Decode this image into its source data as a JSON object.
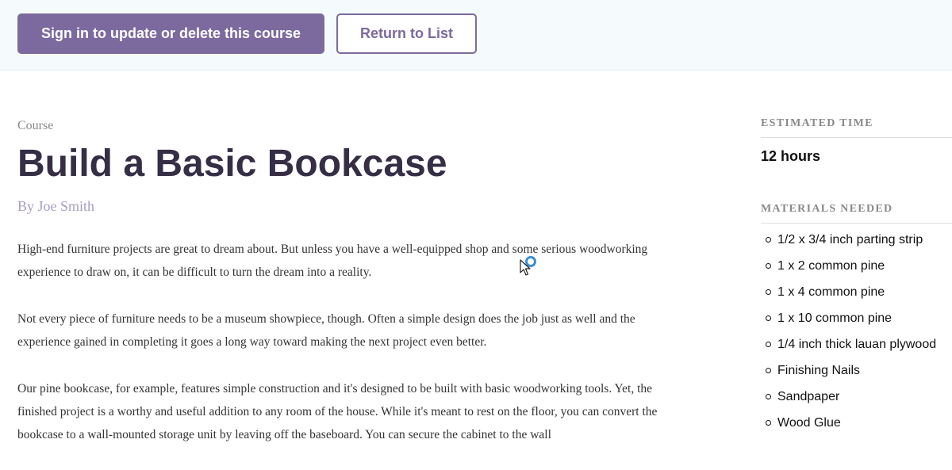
{
  "actions": {
    "primary_label": "Sign in to update or delete this course",
    "secondary_label": "Return to List"
  },
  "course": {
    "kicker": "Course",
    "title": "Build a Basic Bookcase",
    "author": "By Joe Smith",
    "description": [
      "High-end furniture projects are great to dream about. But unless you have a well-equipped shop and some serious woodworking experience to draw on, it can be difficult to turn the dream into a reality.",
      "Not every piece of furniture needs to be a museum showpiece, though. Often a simple design does the job just as well and the experience gained in completing it goes a long way toward making the next project even better.",
      "Our pine bookcase, for example, features simple construction and it's designed to be built with basic woodworking tools. Yet, the finished project is a worthy and useful addition to any room of the house. While it's meant to rest on the floor, you can convert the bookcase to a wall-mounted storage unit by leaving off the baseboard. You can secure the cabinet to the wall"
    ]
  },
  "sidebar": {
    "time_heading": "ESTIMATED TIME",
    "time_value": "12 hours",
    "materials_heading": "MATERIALS NEEDED",
    "materials": [
      "1/2 x 3/4 inch parting strip",
      "1 x 2 common pine",
      "1 x 4 common pine",
      "1 x 10 common pine",
      "1/4 inch thick lauan plywood",
      "Finishing Nails",
      "Sandpaper",
      "Wood Glue"
    ]
  },
  "icons": {
    "cursor": "mouse-cursor-icon",
    "bullet": "circle-bullet-icon"
  },
  "colors": {
    "accent": "#7c6a9e",
    "title": "#352e45",
    "author": "#a89cc3",
    "bar_bg": "#f5fbfd"
  }
}
